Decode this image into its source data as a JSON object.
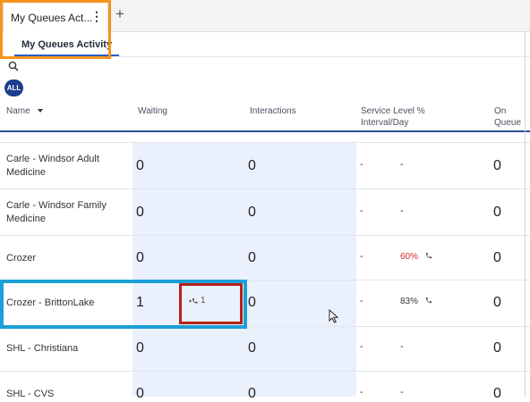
{
  "tabs": {
    "active_label": "My Queues Act...",
    "kebab": "⋮",
    "add": "+"
  },
  "subtab": "My Queues Activity",
  "filter": {
    "all_label": "ALL"
  },
  "columns": {
    "name": "Name",
    "waiting": "Waiting",
    "interactions": "Interactions",
    "service_level_1": "Service Level %",
    "service_level_2": "Interval/Day",
    "on_queue": "On Queue"
  },
  "rows": [
    {
      "name": "Carle - Windsor Adult Medicine",
      "waiting": "0",
      "interactions": "0",
      "sl_interval": "-",
      "sl_day": "-",
      "on_queue": "0"
    },
    {
      "name": "Carle - Windsor Family Medicine",
      "waiting": "0",
      "interactions": "0",
      "sl_interval": "-",
      "sl_day": "-",
      "on_queue": "0"
    },
    {
      "name": "Crozer",
      "waiting": "0",
      "interactions": "0",
      "sl_interval": "-",
      "sl_day": "60%",
      "on_queue": "0"
    },
    {
      "name": "Crozer - BrittonLake",
      "waiting": "1",
      "callbacks": "1",
      "interactions": "0",
      "sl_interval": "-",
      "sl_day": "83%",
      "on_queue": "0"
    },
    {
      "name": "SHL - Christiana",
      "waiting": "0",
      "interactions": "0",
      "sl_interval": "-",
      "sl_day": "-",
      "on_queue": "0"
    },
    {
      "name": "SHL - CVS",
      "waiting": "0",
      "interactions": "0",
      "sl_interval": "-",
      "sl_day": "-",
      "on_queue": "0"
    }
  ],
  "colors": {
    "sl_bad": "#d0312d",
    "sl_ok": "#333333",
    "waiting_bg": "#eaf1fd",
    "accent": "#2e4d99"
  }
}
